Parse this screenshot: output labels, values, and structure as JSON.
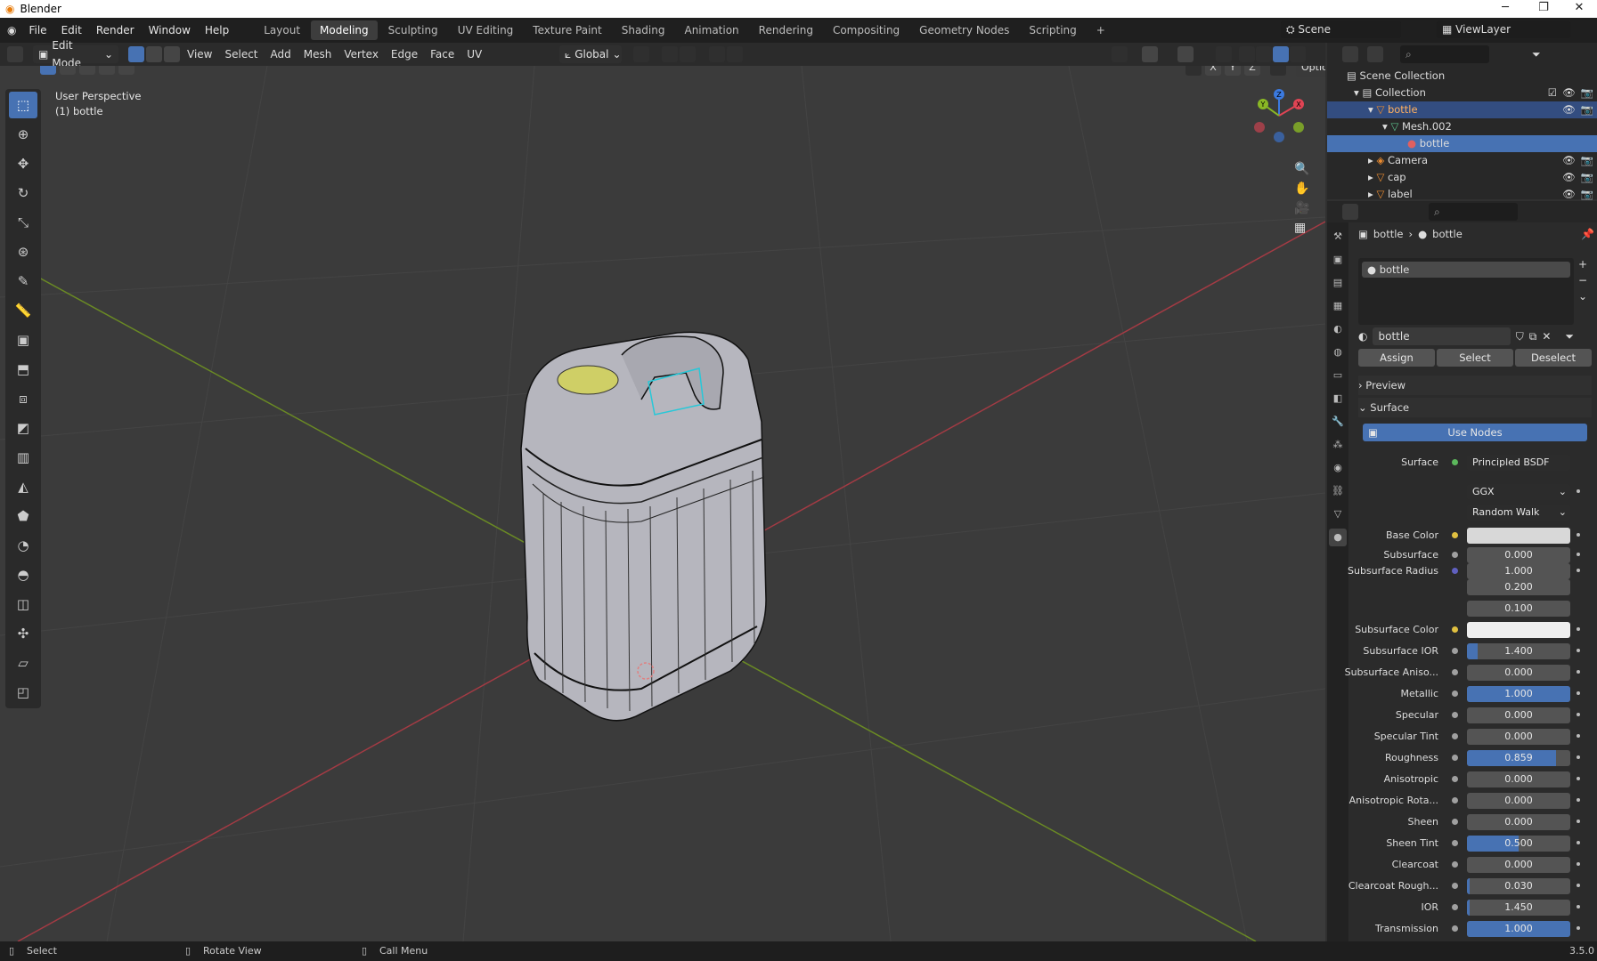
{
  "window": {
    "title": "Blender"
  },
  "menu": {
    "items": [
      "File",
      "Edit",
      "Render",
      "Window",
      "Help"
    ]
  },
  "workspaces": {
    "tabs": [
      "Layout",
      "Modeling",
      "Sculpting",
      "UV Editing",
      "Texture Paint",
      "Shading",
      "Animation",
      "Rendering",
      "Compositing",
      "Geometry Nodes",
      "Scripting"
    ],
    "active": "Modeling",
    "add": "+"
  },
  "scene": {
    "name": "Scene",
    "view_layer": "ViewLayer"
  },
  "viewport_header": {
    "mode": "Edit Mode",
    "menus": [
      "View",
      "Select",
      "Add",
      "Mesh",
      "Vertex",
      "Edge",
      "Face",
      "UV"
    ],
    "orientation": "Global",
    "options": "Options",
    "axes": [
      "X",
      "Y",
      "Z"
    ]
  },
  "viewport": {
    "perspective": "User Perspective",
    "object": "(1) bottle",
    "gizmo": {
      "x": "X",
      "y": "Y",
      "z": "Z"
    }
  },
  "outliner": {
    "rows": [
      {
        "label": "Scene Collection",
        "level": 0
      },
      {
        "label": "Collection",
        "level": 1
      },
      {
        "label": "bottle",
        "level": 2
      },
      {
        "label": "Mesh.002",
        "level": 3
      },
      {
        "label": "bottle",
        "level": 4
      },
      {
        "label": "Camera",
        "level": 2
      },
      {
        "label": "cap",
        "level": 2
      },
      {
        "label": "label",
        "level": 2
      }
    ]
  },
  "properties": {
    "breadcrumb": [
      "bottle",
      "bottle"
    ],
    "slot": "bottle",
    "material_name": "bottle",
    "buttons": {
      "assign": "Assign",
      "select": "Select",
      "deselect": "Deselect"
    },
    "panels": {
      "preview": "Preview",
      "surface": "Surface"
    },
    "use_nodes": "Use Nodes",
    "surface_label": "Surface",
    "surface_shader": "Principled BSDF",
    "distribution": "GGX",
    "subsurface_method": "Random Walk",
    "fields": [
      {
        "label": "Base Color",
        "value": "",
        "fill": 0,
        "color": "#d8d8d8",
        "dot": "#e0c040"
      },
      {
        "label": "Subsurface",
        "value": "0.000",
        "fill": 0
      },
      {
        "label": "Subsurface Radius",
        "value": "1.000",
        "fill": 0,
        "dot": "#6060c0"
      },
      {
        "label": "",
        "value": "0.200",
        "fill": 0
      },
      {
        "label": "",
        "value": "0.100",
        "fill": 0
      },
      {
        "label": "Subsurface Color",
        "value": "",
        "fill": 0,
        "color": "#eeeeee",
        "dot": "#e0c040"
      },
      {
        "label": "Subsurface IOR",
        "value": "1.400",
        "fill": 0.1
      },
      {
        "label": "Subsurface Aniso...",
        "value": "0.000",
        "fill": 0
      },
      {
        "label": "Metallic",
        "value": "1.000",
        "fill": 1
      },
      {
        "label": "Specular",
        "value": "0.000",
        "fill": 0
      },
      {
        "label": "Specular Tint",
        "value": "0.000",
        "fill": 0
      },
      {
        "label": "Roughness",
        "value": "0.859",
        "fill": 0.859
      },
      {
        "label": "Anisotropic",
        "value": "0.000",
        "fill": 0
      },
      {
        "label": "Anisotropic Rota...",
        "value": "0.000",
        "fill": 0
      },
      {
        "label": "Sheen",
        "value": "0.000",
        "fill": 0
      },
      {
        "label": "Sheen Tint",
        "value": "0.500",
        "fill": 0.5
      },
      {
        "label": "Clearcoat",
        "value": "0.000",
        "fill": 0
      },
      {
        "label": "Clearcoat Rough...",
        "value": "0.030",
        "fill": 0.03
      },
      {
        "label": "IOR",
        "value": "1.450",
        "fill": 0.03
      },
      {
        "label": "Transmission",
        "value": "1.000",
        "fill": 1
      }
    ]
  },
  "status": {
    "select": "Select",
    "rotate": "Rotate View",
    "menu": "Call Menu",
    "version": "3.5.0"
  }
}
